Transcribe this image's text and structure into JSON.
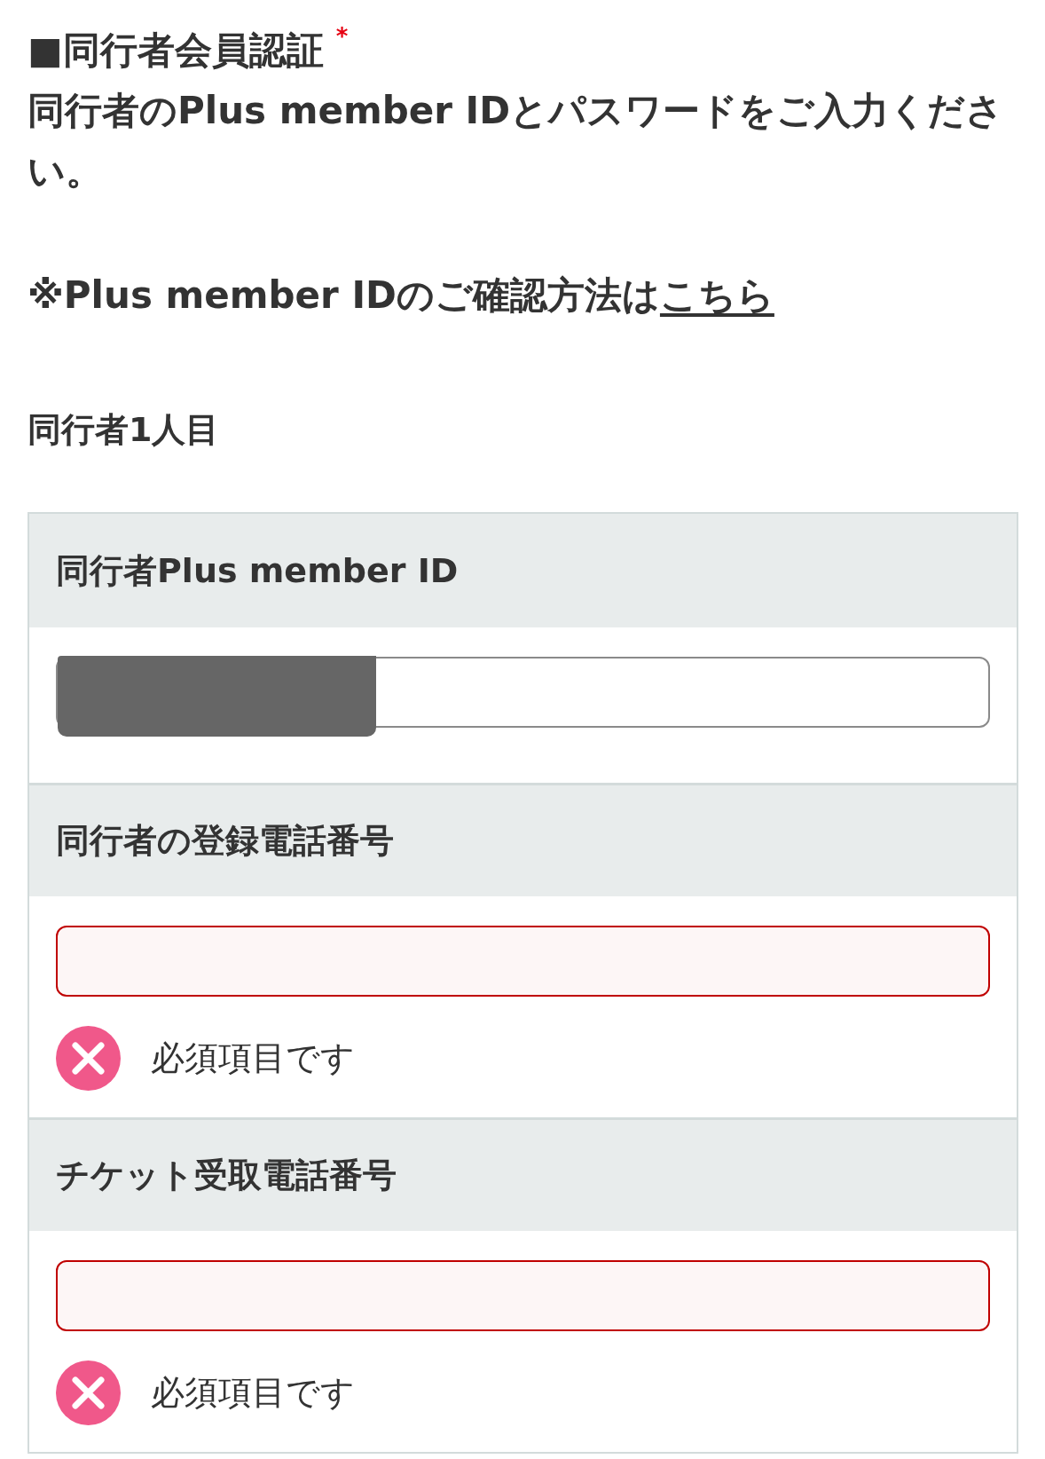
{
  "section": {
    "title": "■同行者会員認証",
    "required_mark": "*",
    "instructions": "同行者のPlus member IDとパスワードをご入力ください。",
    "note": "※Plus member IDのご確認方法は",
    "note_link": "こちら",
    "companion_label": "同行者1人目"
  },
  "fields": [
    {
      "label": "同行者Plus member ID",
      "redacted": true,
      "error": false
    },
    {
      "label": "同行者の登録電話番号",
      "redacted": false,
      "error": true,
      "error_message": "必須項目です"
    },
    {
      "label": "チケット受取電話番号",
      "redacted": false,
      "error": true,
      "error_message": "必須項目です"
    }
  ]
}
